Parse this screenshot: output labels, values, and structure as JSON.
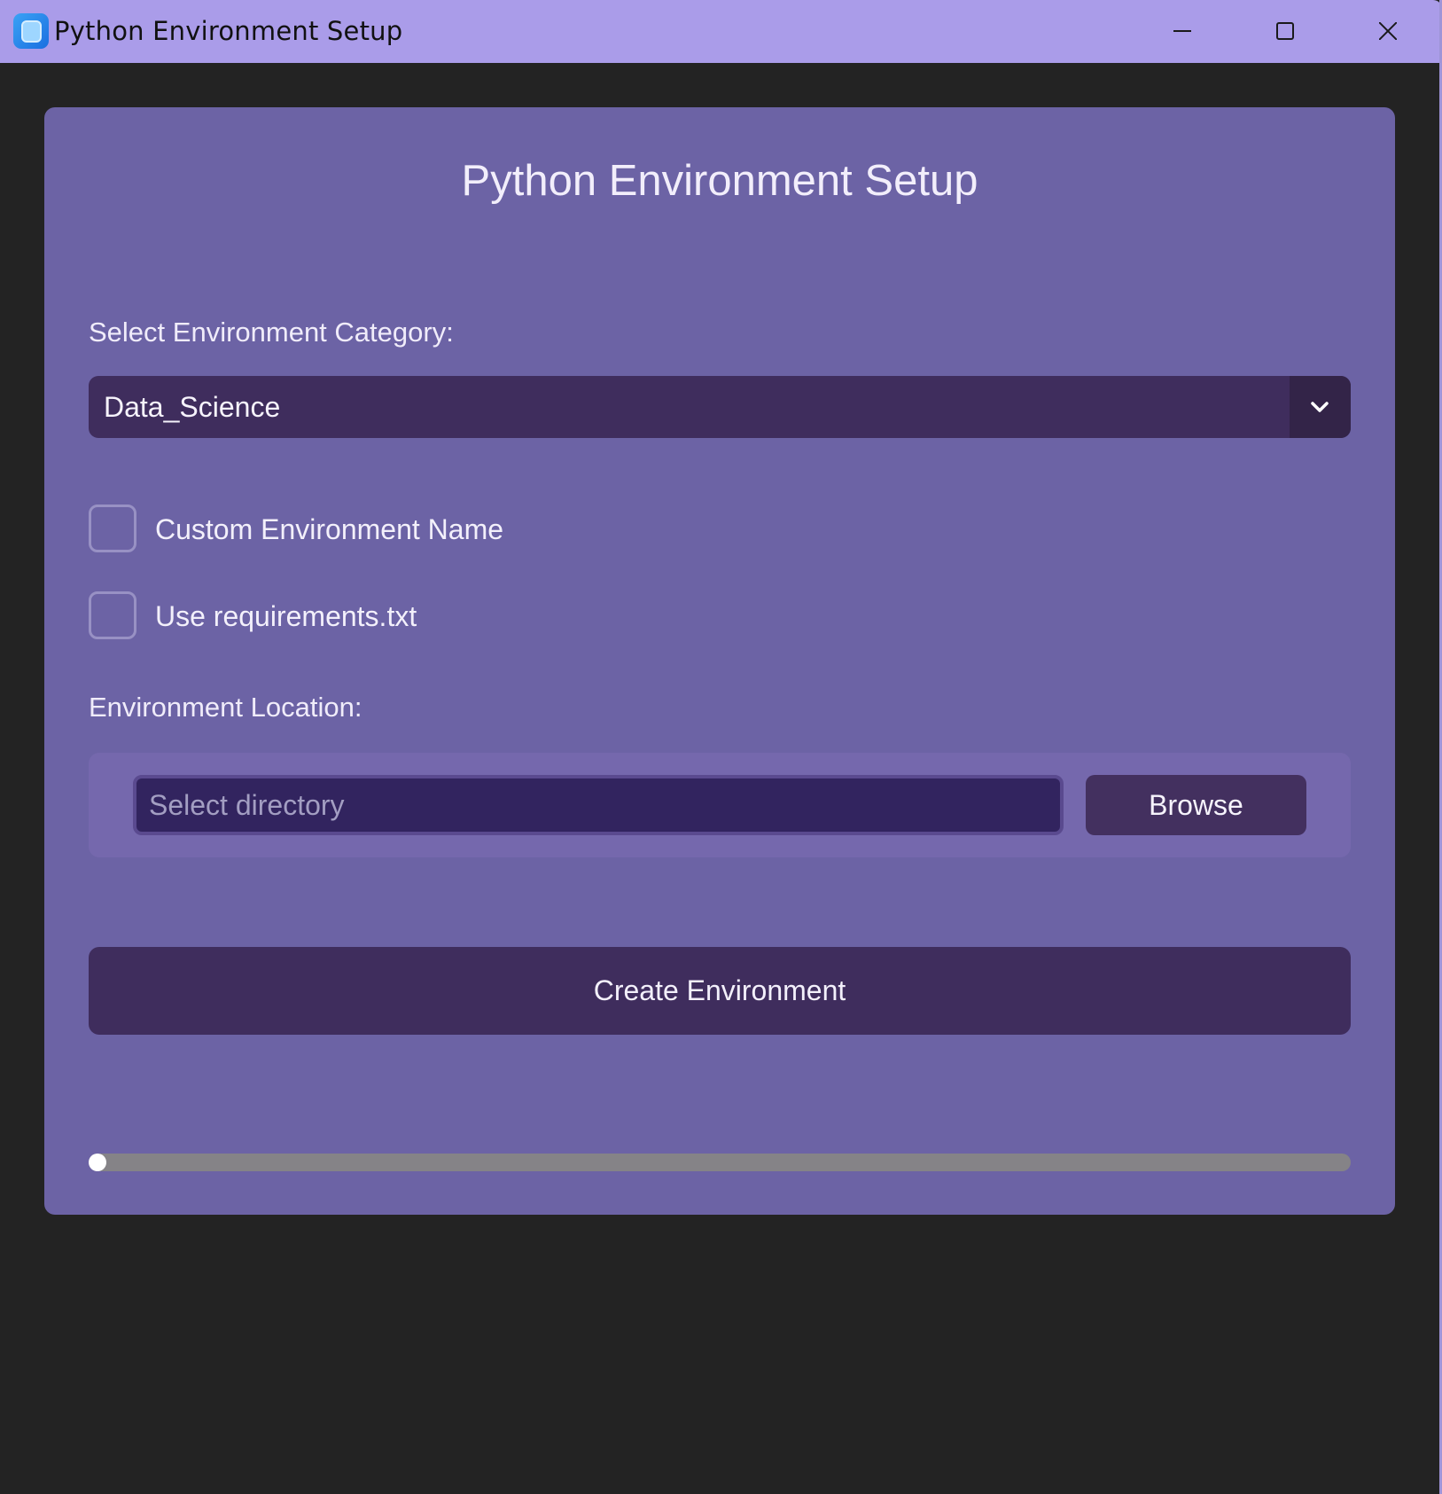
{
  "window": {
    "title": "Python Environment Setup",
    "icon": "app-icon"
  },
  "controls": {
    "minimize_icon": "minimize-icon",
    "maximize_icon": "maximize-icon",
    "close_icon": "close-icon"
  },
  "form": {
    "heading": "Python Environment Setup",
    "category_label": "Select Environment Category:",
    "category_value": "Data_Science",
    "custom_name_label": "Custom Environment Name",
    "custom_name_checked": false,
    "requirements_label": "Use requirements.txt",
    "requirements_checked": false,
    "location_label": "Environment Location:",
    "location_placeholder": "Select directory",
    "location_value": "",
    "browse_label": "Browse",
    "create_label": "Create Environment",
    "progress": 0.0
  },
  "colors": {
    "titlebar": "#aa9ce9",
    "background": "#232323",
    "card": "#6c63a5",
    "control_dark": "#3f2d5d",
    "input_bg": "#32245f"
  }
}
